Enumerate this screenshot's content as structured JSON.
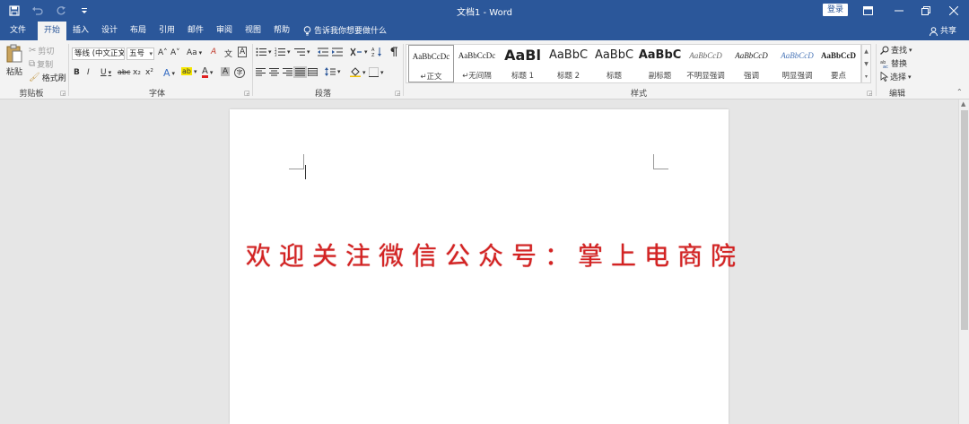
{
  "window": {
    "title": "文档1  -  Word",
    "login_label": "登录"
  },
  "quick_access": {
    "save_icon": "save-icon",
    "undo_icon": "undo-icon",
    "redo_icon": "redo-icon",
    "customize_icon": "customize-qat-icon"
  },
  "tabs": [
    {
      "label": "文件"
    },
    {
      "label": "开始"
    },
    {
      "label": "插入"
    },
    {
      "label": "设计"
    },
    {
      "label": "布局"
    },
    {
      "label": "引用"
    },
    {
      "label": "邮件"
    },
    {
      "label": "审阅"
    },
    {
      "label": "视图"
    },
    {
      "label": "帮助"
    }
  ],
  "active_tab": "开始",
  "tellme": "告诉我你想要做什么",
  "share": "共享",
  "ribbon": {
    "clipboard": {
      "paste": "粘贴",
      "cut": "剪切",
      "copy": "复制",
      "format_painter": "格式刷",
      "group": "剪贴板"
    },
    "font": {
      "font_name": "等线 (中文正文",
      "font_size": "五号",
      "group": "字体",
      "grow": "A˄",
      "shrink": "A˅",
      "case": "Aa",
      "clear": "A",
      "phonetic": "文",
      "border_char": "A",
      "bold": "B",
      "italic": "I",
      "underline": "U",
      "strike": "abc",
      "subscript": "x₂",
      "superscript": "x²",
      "effects": "A",
      "highlight": "ab",
      "font_color": "A",
      "shade": "A",
      "enclose": "字"
    },
    "paragraph": {
      "group": "段落"
    },
    "styles": {
      "group": "样式",
      "items": [
        {
          "preview": "AaBbCcDc",
          "name": "↵正文"
        },
        {
          "preview": "AaBbCcDc",
          "name": "↵无间隔"
        },
        {
          "preview": "AaBl",
          "name": "标题 1"
        },
        {
          "preview": "AaBbC",
          "name": "标题 2"
        },
        {
          "preview": "AaBbC",
          "name": "标题"
        },
        {
          "preview": "AaBbC",
          "name": "副标题"
        },
        {
          "preview": "AaBbCcD",
          "name": "不明显强调"
        },
        {
          "preview": "AaBbCcD",
          "name": "强调"
        },
        {
          "preview": "AaBbCcD",
          "name": "明显强调"
        },
        {
          "preview": "AaBbCcD",
          "name": "要点"
        }
      ]
    },
    "editing": {
      "find": "查找",
      "replace": "替换",
      "select": "选择",
      "group": "编辑"
    }
  },
  "document": {
    "headline": "欢迎关注微信公众号：掌上电商院",
    "headline_color": "#d42323"
  },
  "colors": {
    "title_bar": "#2b579a",
    "ribbon_bg": "#f3f3f3",
    "canvas_bg": "#e6e6e6"
  }
}
